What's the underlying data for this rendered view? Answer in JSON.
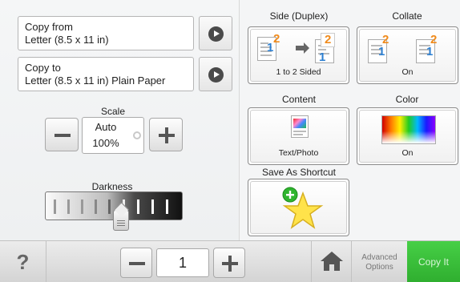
{
  "copy_from": {
    "label": "Copy from",
    "value": "Letter (8.5 x 11 in)"
  },
  "copy_to": {
    "label": "Copy to",
    "value": "Letter (8.5 x 11 in) Plain Paper"
  },
  "scale": {
    "label": "Scale",
    "mode": "Auto",
    "percent": "100%"
  },
  "darkness": {
    "label": "Darkness",
    "level_fraction": 0.5
  },
  "side_duplex": {
    "label": "Side (Duplex)",
    "value": "1 to 2 Sided",
    "num_1": "1",
    "num_2": "2"
  },
  "collate": {
    "label": "Collate",
    "value": "On",
    "num_1": "1",
    "num_2": "2"
  },
  "content": {
    "label": "Content",
    "value": "Text/Photo"
  },
  "color": {
    "label": "Color",
    "value": "On"
  },
  "shortcut": {
    "label": "Save As Shortcut"
  },
  "bottom_bar": {
    "help_label": "?",
    "copies": "1",
    "advanced_label": "Advanced Options",
    "copy_label": "Copy It"
  },
  "icons": [
    "arrow-right-icon",
    "minus-icon",
    "plus-icon",
    "radio-icon",
    "help-icon",
    "home-icon",
    "star-add-icon",
    "duplex-icon",
    "collate-icon",
    "text-photo-icon",
    "color-gradient-icon"
  ],
  "colors": {
    "copy_button": "#3cc23c",
    "accent_blue": "#2c7fd1",
    "accent_orange": "#f08b1c"
  }
}
